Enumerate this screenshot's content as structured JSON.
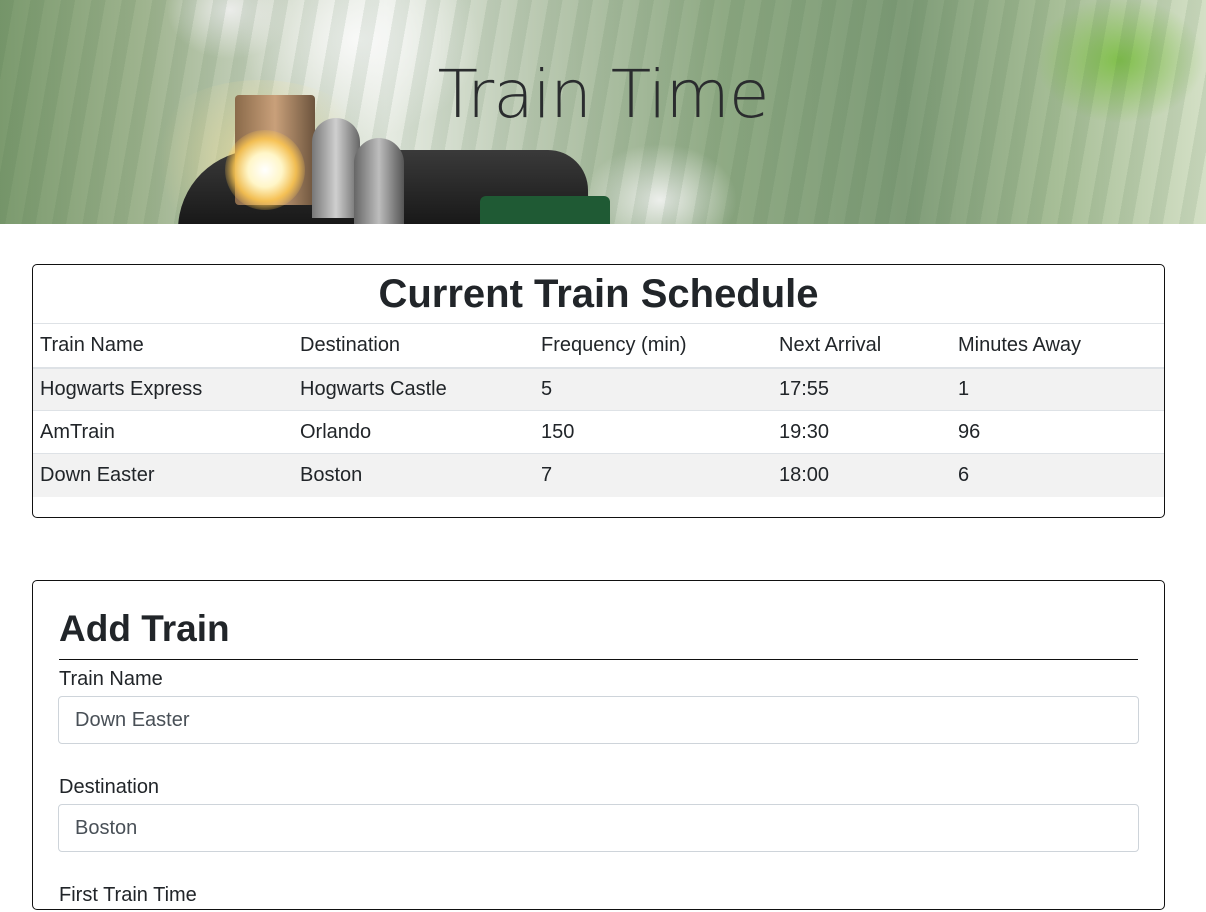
{
  "hero": {
    "title": "Train Time"
  },
  "schedule": {
    "title": "Current Train Schedule",
    "columns": [
      "Train Name",
      "Destination",
      "Frequency (min)",
      "Next Arrival",
      "Minutes Away"
    ],
    "rows": [
      [
        "Hogwarts Express",
        "Hogwarts Castle",
        "5",
        "17:55",
        "1"
      ],
      [
        "AmTrain",
        "Orlando",
        "150",
        "19:30",
        "96"
      ],
      [
        "Down Easter",
        "Boston",
        "7",
        "18:00",
        "6"
      ]
    ]
  },
  "add_train": {
    "title": "Add Train",
    "fields": [
      {
        "label": "Train Name",
        "value": "Down Easter"
      },
      {
        "label": "Destination",
        "value": "Boston"
      },
      {
        "label": "First Train Time",
        "value": ""
      }
    ]
  },
  "colors": {
    "border": "#111111",
    "stripe": "#f2f2f2",
    "text": "#212529"
  }
}
